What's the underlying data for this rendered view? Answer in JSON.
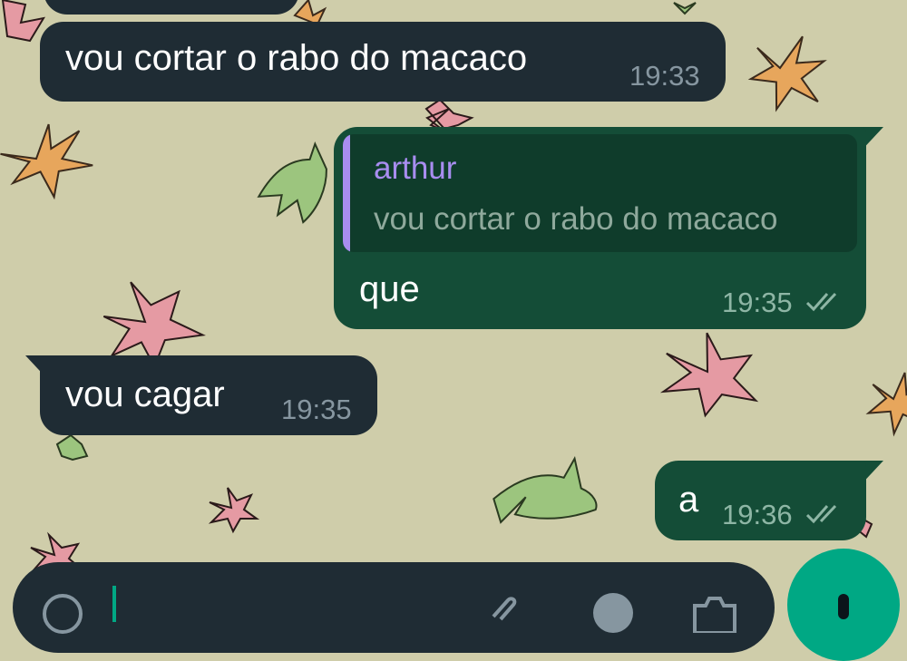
{
  "colors": {
    "wallpaper": "#cfcdaa",
    "incoming_bubble": "#1f2c34",
    "outgoing_bubble": "#144d37",
    "quote_accent": "#a88df0",
    "read_ticks": "#8eb6a5",
    "send_button": "#00a884"
  },
  "messages": [
    {
      "direction": "incoming",
      "text": "vou cortar o rabo do macaco",
      "time": "19:33"
    },
    {
      "direction": "outgoing",
      "reply_to": {
        "author": "arthur",
        "text": "vou cortar o rabo do macaco"
      },
      "text": "que",
      "time": "19:35",
      "status": "read"
    },
    {
      "direction": "incoming",
      "text": "vou cagar",
      "time": "19:35"
    },
    {
      "direction": "outgoing",
      "text": "a",
      "time": "19:36",
      "status": "read"
    }
  ],
  "input_bar": {
    "icons": [
      "emoji-icon",
      "attach-icon",
      "payment-icon",
      "camera-icon"
    ],
    "send_button_icon": "mic-icon"
  }
}
